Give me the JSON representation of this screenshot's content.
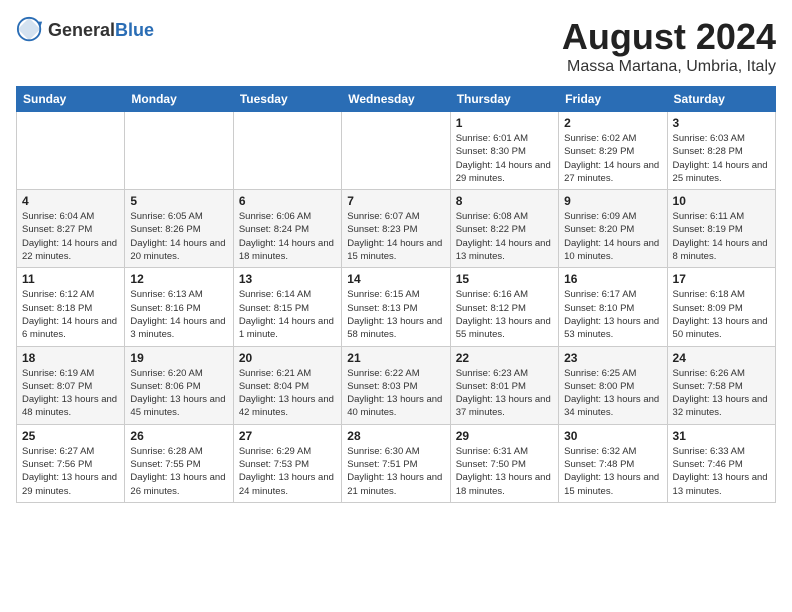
{
  "logo": {
    "general": "General",
    "blue": "Blue"
  },
  "title": "August 2024",
  "subtitle": "Massa Martana, Umbria, Italy",
  "headers": [
    "Sunday",
    "Monday",
    "Tuesday",
    "Wednesday",
    "Thursday",
    "Friday",
    "Saturday"
  ],
  "weeks": [
    [
      {
        "day": "",
        "detail": ""
      },
      {
        "day": "",
        "detail": ""
      },
      {
        "day": "",
        "detail": ""
      },
      {
        "day": "",
        "detail": ""
      },
      {
        "day": "1",
        "detail": "Sunrise: 6:01 AM\nSunset: 8:30 PM\nDaylight: 14 hours and 29 minutes."
      },
      {
        "day": "2",
        "detail": "Sunrise: 6:02 AM\nSunset: 8:29 PM\nDaylight: 14 hours and 27 minutes."
      },
      {
        "day": "3",
        "detail": "Sunrise: 6:03 AM\nSunset: 8:28 PM\nDaylight: 14 hours and 25 minutes."
      }
    ],
    [
      {
        "day": "4",
        "detail": "Sunrise: 6:04 AM\nSunset: 8:27 PM\nDaylight: 14 hours and 22 minutes."
      },
      {
        "day": "5",
        "detail": "Sunrise: 6:05 AM\nSunset: 8:26 PM\nDaylight: 14 hours and 20 minutes."
      },
      {
        "day": "6",
        "detail": "Sunrise: 6:06 AM\nSunset: 8:24 PM\nDaylight: 14 hours and 18 minutes."
      },
      {
        "day": "7",
        "detail": "Sunrise: 6:07 AM\nSunset: 8:23 PM\nDaylight: 14 hours and 15 minutes."
      },
      {
        "day": "8",
        "detail": "Sunrise: 6:08 AM\nSunset: 8:22 PM\nDaylight: 14 hours and 13 minutes."
      },
      {
        "day": "9",
        "detail": "Sunrise: 6:09 AM\nSunset: 8:20 PM\nDaylight: 14 hours and 10 minutes."
      },
      {
        "day": "10",
        "detail": "Sunrise: 6:11 AM\nSunset: 8:19 PM\nDaylight: 14 hours and 8 minutes."
      }
    ],
    [
      {
        "day": "11",
        "detail": "Sunrise: 6:12 AM\nSunset: 8:18 PM\nDaylight: 14 hours and 6 minutes."
      },
      {
        "day": "12",
        "detail": "Sunrise: 6:13 AM\nSunset: 8:16 PM\nDaylight: 14 hours and 3 minutes."
      },
      {
        "day": "13",
        "detail": "Sunrise: 6:14 AM\nSunset: 8:15 PM\nDaylight: 14 hours and 1 minute."
      },
      {
        "day": "14",
        "detail": "Sunrise: 6:15 AM\nSunset: 8:13 PM\nDaylight: 13 hours and 58 minutes."
      },
      {
        "day": "15",
        "detail": "Sunrise: 6:16 AM\nSunset: 8:12 PM\nDaylight: 13 hours and 55 minutes."
      },
      {
        "day": "16",
        "detail": "Sunrise: 6:17 AM\nSunset: 8:10 PM\nDaylight: 13 hours and 53 minutes."
      },
      {
        "day": "17",
        "detail": "Sunrise: 6:18 AM\nSunset: 8:09 PM\nDaylight: 13 hours and 50 minutes."
      }
    ],
    [
      {
        "day": "18",
        "detail": "Sunrise: 6:19 AM\nSunset: 8:07 PM\nDaylight: 13 hours and 48 minutes."
      },
      {
        "day": "19",
        "detail": "Sunrise: 6:20 AM\nSunset: 8:06 PM\nDaylight: 13 hours and 45 minutes."
      },
      {
        "day": "20",
        "detail": "Sunrise: 6:21 AM\nSunset: 8:04 PM\nDaylight: 13 hours and 42 minutes."
      },
      {
        "day": "21",
        "detail": "Sunrise: 6:22 AM\nSunset: 8:03 PM\nDaylight: 13 hours and 40 minutes."
      },
      {
        "day": "22",
        "detail": "Sunrise: 6:23 AM\nSunset: 8:01 PM\nDaylight: 13 hours and 37 minutes."
      },
      {
        "day": "23",
        "detail": "Sunrise: 6:25 AM\nSunset: 8:00 PM\nDaylight: 13 hours and 34 minutes."
      },
      {
        "day": "24",
        "detail": "Sunrise: 6:26 AM\nSunset: 7:58 PM\nDaylight: 13 hours and 32 minutes."
      }
    ],
    [
      {
        "day": "25",
        "detail": "Sunrise: 6:27 AM\nSunset: 7:56 PM\nDaylight: 13 hours and 29 minutes."
      },
      {
        "day": "26",
        "detail": "Sunrise: 6:28 AM\nSunset: 7:55 PM\nDaylight: 13 hours and 26 minutes."
      },
      {
        "day": "27",
        "detail": "Sunrise: 6:29 AM\nSunset: 7:53 PM\nDaylight: 13 hours and 24 minutes."
      },
      {
        "day": "28",
        "detail": "Sunrise: 6:30 AM\nSunset: 7:51 PM\nDaylight: 13 hours and 21 minutes."
      },
      {
        "day": "29",
        "detail": "Sunrise: 6:31 AM\nSunset: 7:50 PM\nDaylight: 13 hours and 18 minutes."
      },
      {
        "day": "30",
        "detail": "Sunrise: 6:32 AM\nSunset: 7:48 PM\nDaylight: 13 hours and 15 minutes."
      },
      {
        "day": "31",
        "detail": "Sunrise: 6:33 AM\nSunset: 7:46 PM\nDaylight: 13 hours and 13 minutes."
      }
    ]
  ]
}
